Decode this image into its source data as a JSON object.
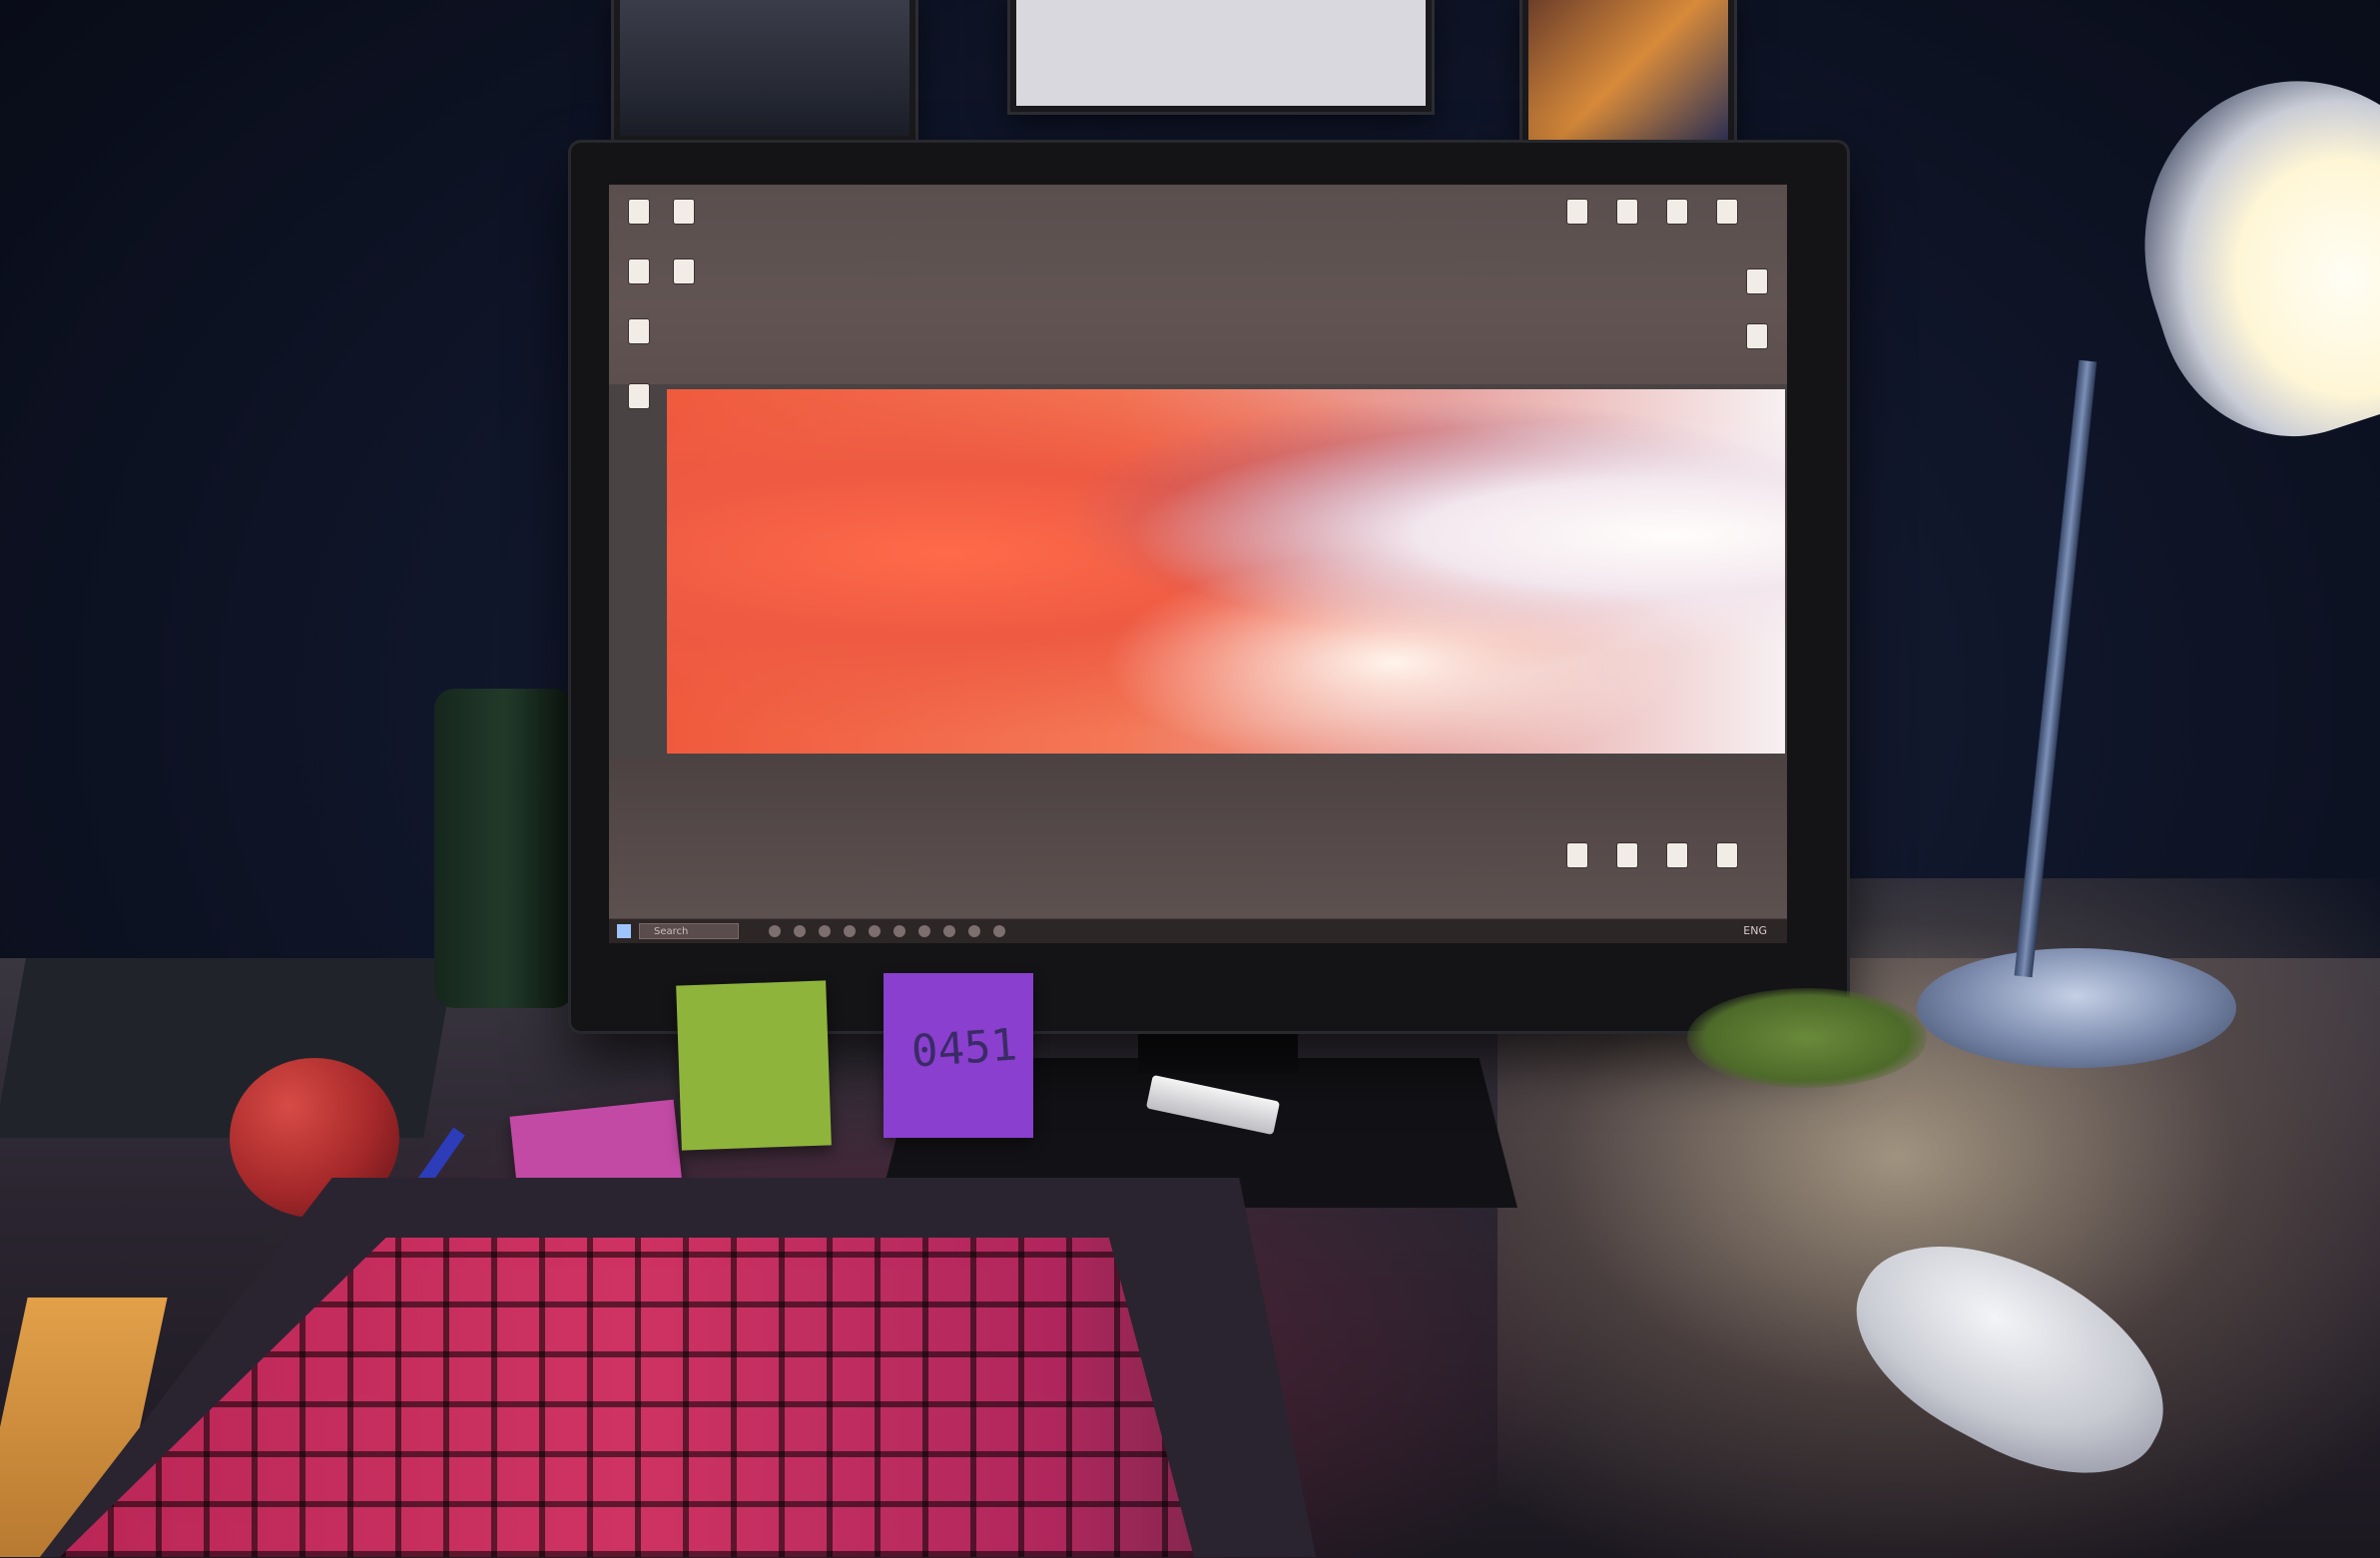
{
  "scene": {
    "wallpaper_colors": [
      "#f05a3c",
      "#e7a3a0",
      "#f7f0f2"
    ],
    "keyboard_color": "#d83466",
    "lamp_light": "#fff6d6"
  },
  "taskbar": {
    "search_text": "Search",
    "tray_text": "ENG"
  },
  "desktop_icons": [
    {
      "label": ""
    },
    {
      "label": ""
    },
    {
      "label": ""
    },
    {
      "label": ""
    },
    {
      "label": ""
    },
    {
      "label": ""
    }
  ],
  "sticky_notes": {
    "purple_note_text": "0451"
  }
}
